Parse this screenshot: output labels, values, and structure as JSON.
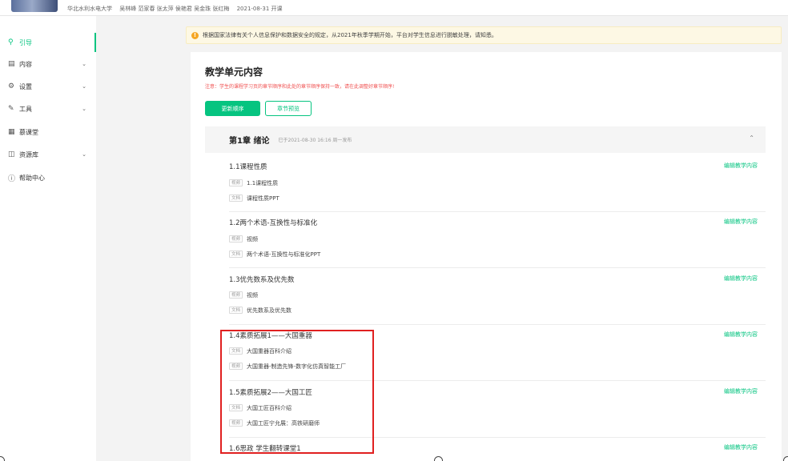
{
  "header": {
    "school": "华北水利水电大学",
    "teachers": "吴林峰 范家春 张太萍 侯艳君 吴金珠 张红梅",
    "start_date": "2021-08-31 开课"
  },
  "sidebar": {
    "items": [
      {
        "label": "引导",
        "icon": "lightbulb-icon",
        "has_chevron": false,
        "active": true
      },
      {
        "label": "内容",
        "icon": "document-icon",
        "has_chevron": true,
        "active": false
      },
      {
        "label": "设置",
        "icon": "gear-icon",
        "has_chevron": true,
        "active": false
      },
      {
        "label": "工具",
        "icon": "wrench-icon",
        "has_chevron": true,
        "active": false
      },
      {
        "label": "慕课堂",
        "icon": "classroom-icon",
        "has_chevron": false,
        "active": false
      },
      {
        "label": "资源库",
        "icon": "database-icon",
        "has_chevron": true,
        "active": false
      },
      {
        "label": "帮助中心",
        "icon": "help-icon",
        "has_chevron": false,
        "active": false
      }
    ]
  },
  "notice": {
    "icon": "warning-icon",
    "text": "根据国家法律有关个人信息保护和数据安全的规定，从2021年秋季学期开始，平台对学生信息进行脱敏处理，请知悉。"
  },
  "panel": {
    "title": "教学单元内容",
    "note": "注意：学生的课程学习页的章节顺序和此处的章节顺序保持一致，请在此调整好章节顺序!",
    "update_order_label": "更新顺序",
    "preview_label": "章节预览"
  },
  "chapter": {
    "title": "第1章 绪论",
    "published": "已于2021-08-30 16:16 周一发布",
    "toggle_icon": "chevron-up-icon"
  },
  "sections": [
    {
      "title": "1.1课程性质",
      "edit_label": "编辑教学内容",
      "resources": [
        {
          "tag": "视频",
          "name": "1.1课程性质"
        },
        {
          "tag": "文档",
          "name": "课程性质PPT"
        }
      ]
    },
    {
      "title": "1.2两个术语-互换性与标准化",
      "edit_label": "编辑教学内容",
      "resources": [
        {
          "tag": "视频",
          "name": "视频"
        },
        {
          "tag": "文档",
          "name": "两个术语-互换性与标准化PPT"
        }
      ]
    },
    {
      "title": "1.3优先数系及优先数",
      "edit_label": "编辑教学内容",
      "resources": [
        {
          "tag": "视频",
          "name": "视频"
        },
        {
          "tag": "文档",
          "name": "优先数系及优先数"
        }
      ]
    },
    {
      "title": "1.4素质拓展1——大国重器",
      "edit_label": "编辑教学内容",
      "resources": [
        {
          "tag": "文档",
          "name": "大国重器百科介绍"
        },
        {
          "tag": "视频",
          "name": "大国重器-制造先锋-数字化仿真智能工厂"
        }
      ]
    },
    {
      "title": "1.5素质拓展2——大国工匠",
      "edit_label": "编辑教学内容",
      "resources": [
        {
          "tag": "文档",
          "name": "大国工匠百科介绍"
        },
        {
          "tag": "视频",
          "name": "大国工匠宁允展：高铁研磨师"
        }
      ]
    },
    {
      "title": "1.6思政 学生翻转课堂1",
      "edit_label": "编辑教学内容",
      "resources": []
    }
  ],
  "colors": {
    "accent": "#06c480",
    "note": "#f04f4f",
    "highlight": "#e02020",
    "notice_bg": "#fdf8e4"
  }
}
